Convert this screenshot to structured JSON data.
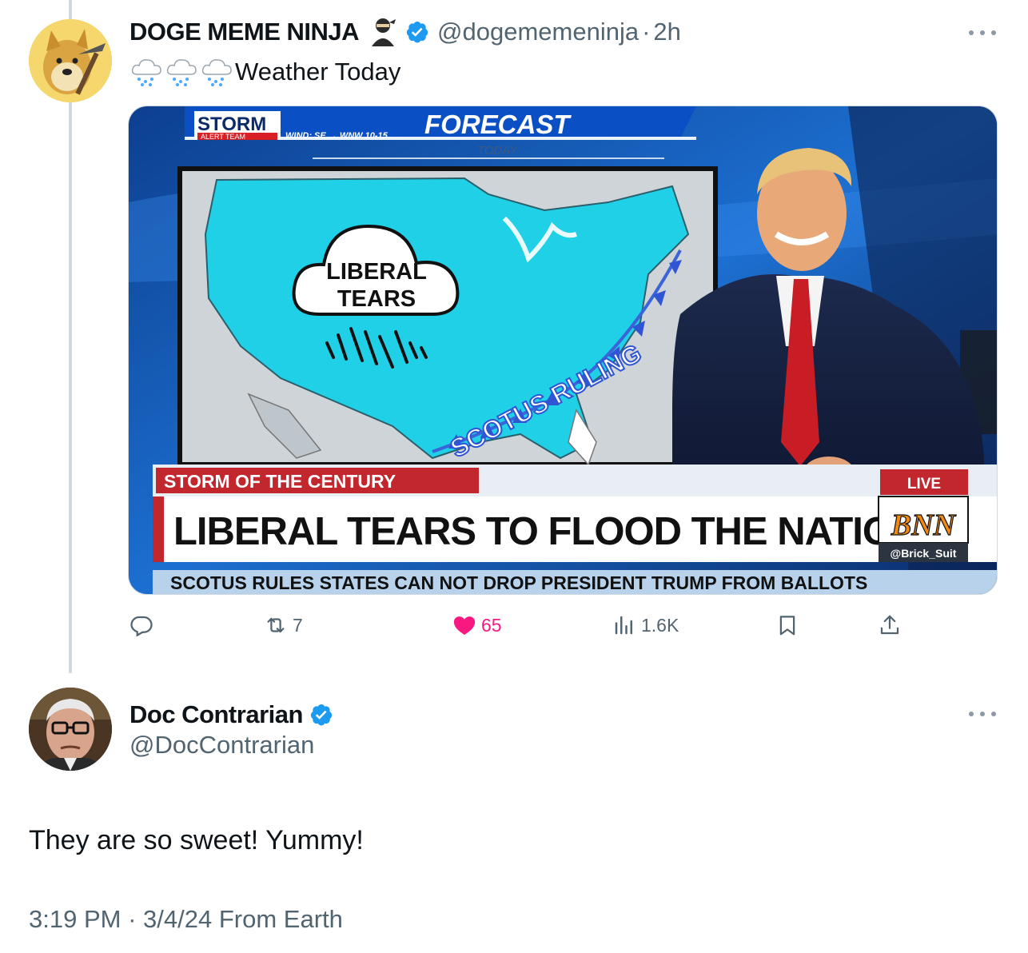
{
  "parent_tweet": {
    "display_name": "DOGE MEME NINJA",
    "handle": "@dogememeninja",
    "time": "2h",
    "text": "Weather Today",
    "emoji": [
      "cloud-with-rain",
      "cloud-with-rain",
      "cloud-with-rain"
    ],
    "media": {
      "storm_logo": "STORM",
      "storm_sub": "ALERT TEAM",
      "wind": "WIND: SE → WNW 10-15",
      "forecast": "FORECAST",
      "today": "TODAY",
      "cloud_line1": "LIBERAL",
      "cloud_line2": "TEARS",
      "front_label": "SCOTUS RULING",
      "lower_third_tag": "STORM OF THE CENTURY",
      "live": "LIVE",
      "headline": "LIBERAL TEARS TO FLOOD THE NATION",
      "network": "BNN",
      "network_handle": "@Brick_Suit",
      "ticker": "SCOTUS RULES STATES CAN NOT DROP PRESIDENT TRUMP FROM BALLOTS"
    },
    "stats": {
      "replies": "",
      "retweets": "7",
      "likes": "65",
      "views": "1.6K"
    }
  },
  "reply_tweet": {
    "display_name": "Doc Contrarian",
    "handle": "@DocContrarian",
    "text": "They are so sweet! Yummy!",
    "time": "3:19 PM",
    "date": "3/4/24",
    "source": "From Earth"
  },
  "colors": {
    "verified": "#1d9bf0",
    "like": "#f91880",
    "muted": "#536471",
    "map_fill": "#1fd0e6",
    "news_red": "#c1272d"
  }
}
